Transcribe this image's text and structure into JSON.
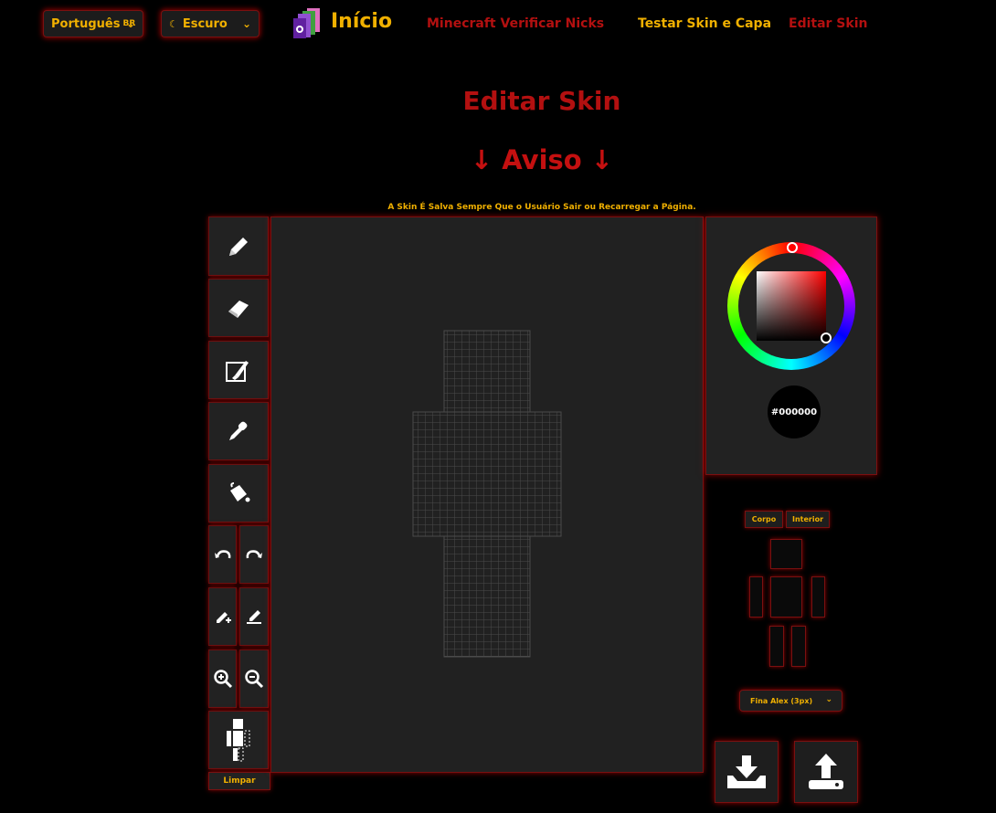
{
  "header": {
    "language": {
      "label": "Português",
      "suffix": "BR"
    },
    "theme": {
      "icon": "moon-icon",
      "label": "Escuro"
    },
    "home_label": "Início",
    "links": [
      {
        "label": "Minecraft Verificar Nicks",
        "color": "#b31010"
      },
      {
        "label": "Testar Skin e Capa",
        "color": "#f0b000"
      },
      {
        "label": "Editar Skin",
        "color": "#b31010"
      }
    ]
  },
  "main": {
    "title": "Editar Skin",
    "aviso": "↓ Aviso ↓",
    "notice": "A Skin É Salva Sempre Que o Usuário Sair ou Recarregar a Página."
  },
  "tools": {
    "icons": [
      "pencil-icon",
      "eraser-icon",
      "brush-icon",
      "eyedropper-icon",
      "paint-bucket-icon",
      "undo-icon",
      "redo-icon",
      "pen-add-icon",
      "pen-remove-icon",
      "zoom-in-icon",
      "zoom-out-icon",
      "body-layers-icon"
    ],
    "clear_label": "Limpar"
  },
  "color": {
    "hex": "#000000",
    "accent": "#f0b000",
    "brand_red": "#b31010"
  },
  "layers": {
    "tabs": [
      "Corpo",
      "Interior"
    ]
  },
  "model": {
    "selected": "Fina Alex (3px)"
  },
  "actions": {
    "icons": [
      "download-icon",
      "upload-icon"
    ]
  }
}
